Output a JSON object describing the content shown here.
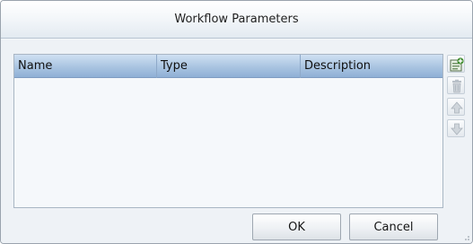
{
  "dialog": {
    "title": "Workflow Parameters"
  },
  "grid": {
    "columns": [
      "Name",
      "Type",
      "Description"
    ],
    "rows": []
  },
  "toolbar": {
    "icons": [
      "add-parameter-icon",
      "delete-icon",
      "move-up-icon",
      "move-down-icon"
    ]
  },
  "buttons": {
    "ok_label": "OK",
    "cancel_label": "Cancel"
  },
  "colors": {
    "header_accent": "#a9c4e1",
    "add_icon_green": "#3d8c2c",
    "disabled_icon": "#b9c0c8"
  }
}
